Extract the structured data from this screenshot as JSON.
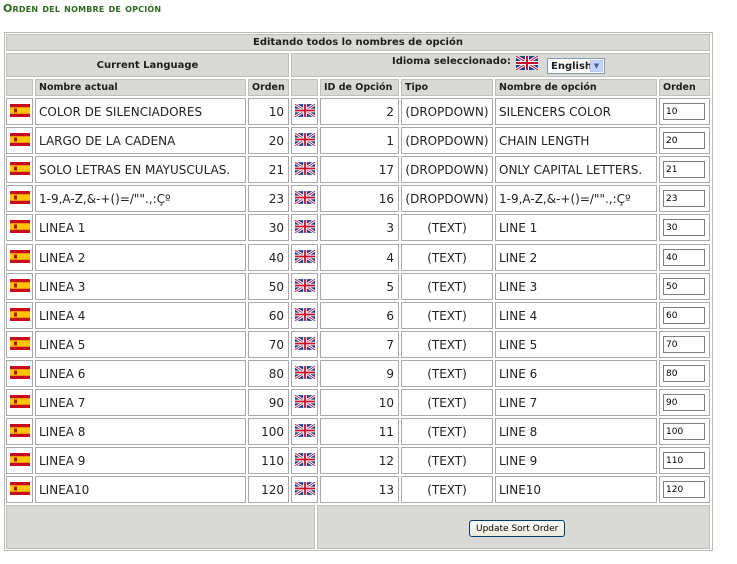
{
  "page_title": "Orden del nombre de opción",
  "header": {
    "main": "Editando todos lo nombres de opción",
    "current_language": "Current Language",
    "idioma_label": "Idioma seleccionado:",
    "language_select": "English"
  },
  "columns": {
    "nombre_actual": "Nombre actual",
    "orden": "Orden",
    "id_opcion": "ID de Opción",
    "tipo": "Tipo",
    "nombre_opcion": "Nombre de opción",
    "orden2": "Orden"
  },
  "rows": [
    {
      "nombre": "COLOR DE SILENCIADORES",
      "orden": "10",
      "id": "2",
      "tipo": "(DROPDOWN)",
      "nombre_en": "SILENCERS COLOR",
      "orden_input": "10"
    },
    {
      "nombre": "LARGO DE LA CADENA",
      "orden": "20",
      "id": "1",
      "tipo": "(DROPDOWN)",
      "nombre_en": "CHAIN LENGTH",
      "orden_input": "20"
    },
    {
      "nombre": "SOLO LETRAS EN MAYUSCULAS.",
      "orden": "21",
      "id": "17",
      "tipo": "(DROPDOWN)",
      "nombre_en": "ONLY CAPITAL LETTERS.",
      "orden_input": "21"
    },
    {
      "nombre": "1-9,A-Z,&-+()=/\"\".,:Çº",
      "orden": "23",
      "id": "16",
      "tipo": "(DROPDOWN)",
      "nombre_en": "1-9,A-Z,&-+()=/\"\".,:Çº",
      "orden_input": "23"
    },
    {
      "nombre": "LINEA 1",
      "orden": "30",
      "id": "3",
      "tipo": "(TEXT)",
      "nombre_en": "LINE 1",
      "orden_input": "30"
    },
    {
      "nombre": "LINEA 2",
      "orden": "40",
      "id": "4",
      "tipo": "(TEXT)",
      "nombre_en": "LINE 2",
      "orden_input": "40"
    },
    {
      "nombre": "LINEA 3",
      "orden": "50",
      "id": "5",
      "tipo": "(TEXT)",
      "nombre_en": "LINE 3",
      "orden_input": "50"
    },
    {
      "nombre": "LINEA 4",
      "orden": "60",
      "id": "6",
      "tipo": "(TEXT)",
      "nombre_en": "LINE 4",
      "orden_input": "60"
    },
    {
      "nombre": "LINEA 5",
      "orden": "70",
      "id": "7",
      "tipo": "(TEXT)",
      "nombre_en": "LINE 5",
      "orden_input": "70"
    },
    {
      "nombre": "LINEA 6",
      "orden": "80",
      "id": "9",
      "tipo": "(TEXT)",
      "nombre_en": "LINE 6",
      "orden_input": "80"
    },
    {
      "nombre": "LINEA 7",
      "orden": "90",
      "id": "10",
      "tipo": "(TEXT)",
      "nombre_en": "LINE 7",
      "orden_input": "90"
    },
    {
      "nombre": "LINEA 8",
      "orden": "100",
      "id": "11",
      "tipo": "(TEXT)",
      "nombre_en": "LINE 8",
      "orden_input": "100"
    },
    {
      "nombre": "LINEA 9",
      "orden": "110",
      "id": "12",
      "tipo": "(TEXT)",
      "nombre_en": "LINE 9",
      "orden_input": "110"
    },
    {
      "nombre": "LINEA10",
      "orden": "120",
      "id": "13",
      "tipo": "(TEXT)",
      "nombre_en": "LINE10",
      "orden_input": "120"
    }
  ],
  "update_button": "Update Sort Order",
  "icons": {
    "spanish_flag": "spain-flag-icon",
    "uk_flag": "uk-flag-icon"
  },
  "colors": {
    "title_green": "#2d6a1f",
    "header_gray": "#d9d9d6"
  }
}
